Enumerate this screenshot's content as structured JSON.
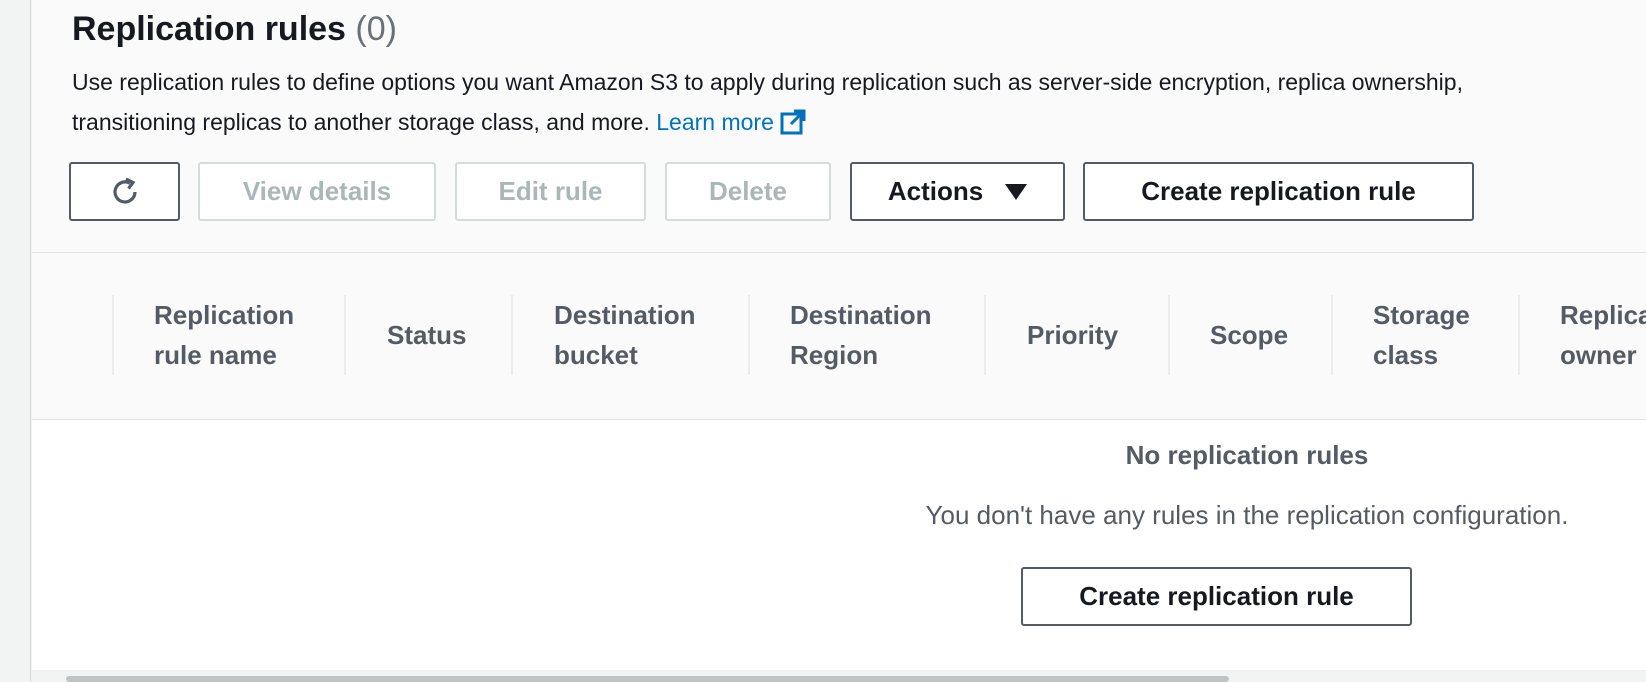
{
  "section": {
    "title": "Replication rules",
    "count": "(0)",
    "description": "Use replication rules to define options you want Amazon S3 to apply during replication such as server-side encryption, replica ownership, transitioning replicas to another storage class, and more.",
    "learn_more": "Learn more"
  },
  "toolbar": {
    "refresh_icon": "refresh-icon",
    "view_details": "View details",
    "edit_rule": "Edit rule",
    "delete": "Delete",
    "actions": "Actions",
    "create_rule": "Create replication rule"
  },
  "table": {
    "columns": [
      {
        "line1": "Replication",
        "line2": "rule name"
      },
      {
        "line1": "Status",
        "line2": ""
      },
      {
        "line1": "Destination",
        "line2": "bucket"
      },
      {
        "line1": "Destination",
        "line2": "Region"
      },
      {
        "line1": "Priority",
        "line2": ""
      },
      {
        "line1": "Scope",
        "line2": ""
      },
      {
        "line1": "Storage",
        "line2": "class"
      },
      {
        "line1": "Replica",
        "line2": "owner"
      }
    ],
    "rows": []
  },
  "empty_state": {
    "title": "No replication rules",
    "description": "You don't have any rules in the replication configuration.",
    "button": "Create replication rule"
  },
  "colors": {
    "link": "#0073bb",
    "border_dark": "#545b64",
    "disabled_text": "#aab7b8"
  }
}
